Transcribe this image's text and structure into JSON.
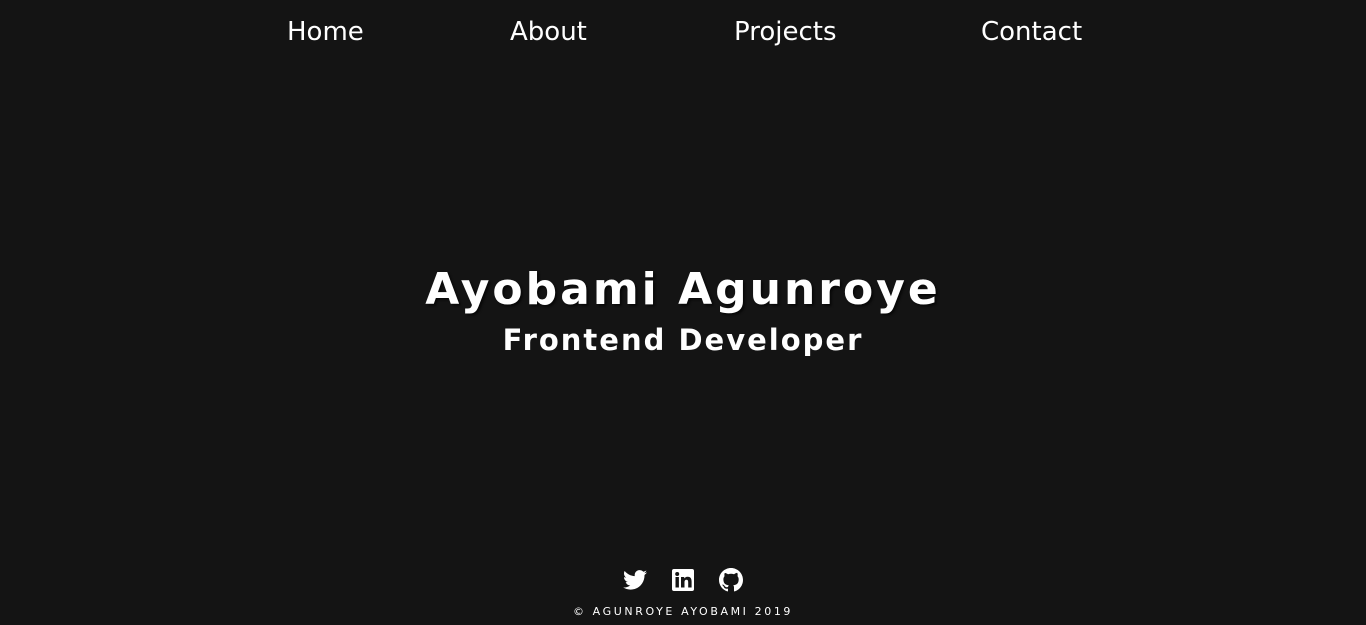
{
  "nav": {
    "items": [
      {
        "label": "Home"
      },
      {
        "label": "About"
      },
      {
        "label": "Projects"
      },
      {
        "label": "Contact"
      }
    ]
  },
  "hero": {
    "name": "Ayobami Agunroye",
    "role": "Frontend Developer"
  },
  "footer": {
    "social": [
      {
        "icon": "twitter-icon"
      },
      {
        "icon": "linkedin-icon"
      },
      {
        "icon": "github-icon"
      }
    ],
    "copyright": "© AGUNROYE AYOBAMI 2019"
  },
  "colors": {
    "background": "#141414",
    "text": "#ffffff"
  }
}
